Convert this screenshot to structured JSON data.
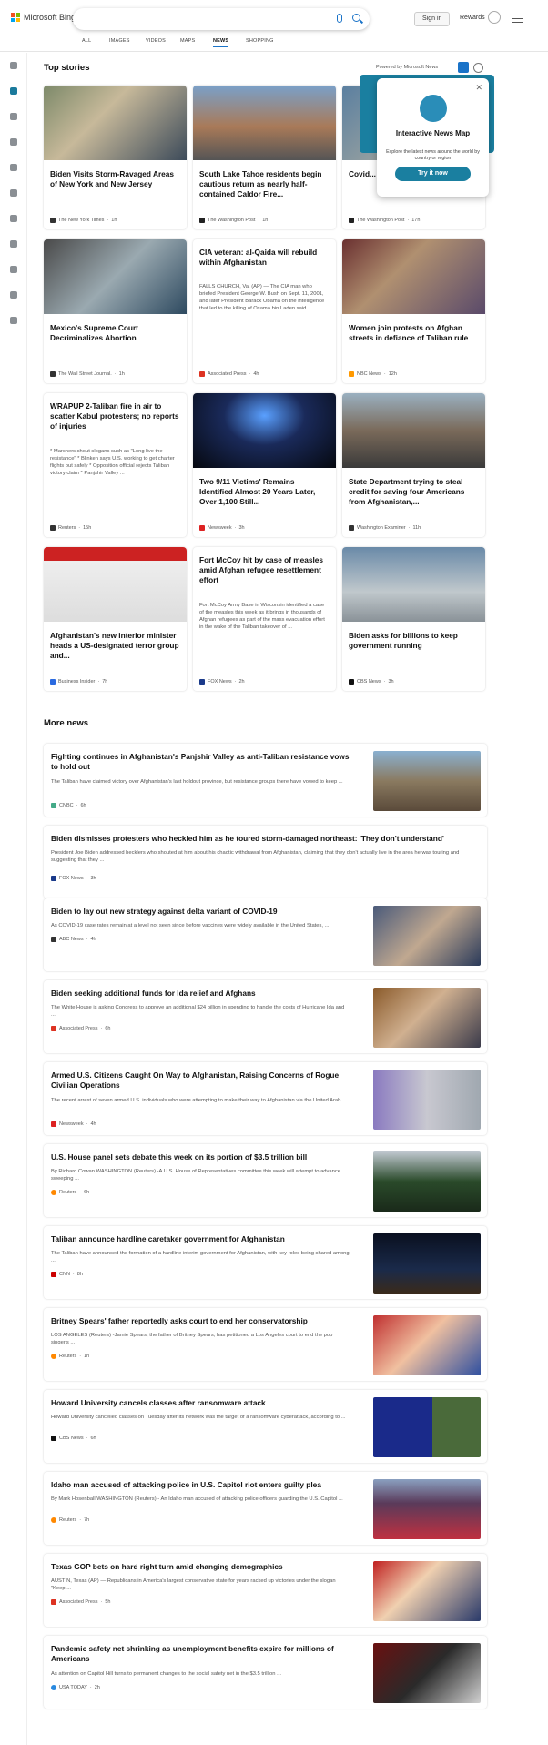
{
  "header": {
    "logo_text": "Microsoft Bing",
    "signin": "Sign in",
    "rewards": "Rewards"
  },
  "tabs": [
    "ALL",
    "IMAGES",
    "VIDEOS",
    "MAPS",
    "NEWS",
    "SHOPPING"
  ],
  "top": {
    "title": "Top stories",
    "powered": "Powered by Microsoft News"
  },
  "popup": {
    "title": "Interactive News Map",
    "desc": "Explore the latest news around the world by country or region",
    "button": "Try it now"
  },
  "cards": [
    {
      "title": "Biden Visits Storm-Ravaged Areas of New York and New Jersey",
      "desc": "",
      "source": "The New York Times",
      "age": "1h"
    },
    {
      "title": "South Lake Tahoe residents begin cautious return as nearly half-contained Caldor Fire...",
      "desc": "",
      "source": "The Washington Post",
      "age": "1h"
    },
    {
      "title": "Covid... move... medi...",
      "desc": "",
      "source": "The Washington Post",
      "age": "17h"
    },
    {
      "title": "Mexico's Supreme Court Decriminalizes Abortion",
      "desc": "",
      "source": "The Wall Street Journal.",
      "age": "1h"
    },
    {
      "title": "CIA veteran: al-Qaida will rebuild within Afghanistan",
      "desc": "FALLS CHURCH, Va. (AP) — The CIA man who briefed President George W. Bush on Sept. 11, 2001, and later President Barack Obama on the intelligence that led to the killing of Osama bin Laden said ...",
      "source": "Associated Press",
      "age": "4h"
    },
    {
      "title": "Women join protests on Afghan streets in defiance of Taliban rule",
      "desc": "",
      "source": "NBC News",
      "age": "12h"
    },
    {
      "title": "WRAPUP 2-Taliban fire in air to scatter Kabul protesters; no reports of injuries",
      "desc": "* Marchers shout slogans such as \"Long live the resistance\" * Blinken says U.S. working to get charter flights out safely * Opposition official rejects Taliban victory claim * Panjshir Valley ...",
      "source": "Reuters",
      "age": "15h"
    },
    {
      "title": "Two 9/11 Victims' Remains Identified Almost 20 Years Later, Over 1,100 Still...",
      "desc": "",
      "source": "Newsweek",
      "age": "3h"
    },
    {
      "title": "State Department trying to steal credit for saving four Americans from Afghanistan,...",
      "desc": "",
      "source": "Washington Examiner",
      "age": "11h"
    },
    {
      "title": "Afghanistan's new interior minister heads a US-designated terror group and...",
      "desc": "",
      "source": "Business Insider",
      "age": "7h"
    },
    {
      "title": "Fort McCoy hit by case of measles amid Afghan refugee resettlement effort",
      "desc": "Fort McCoy Army Base in Wisconsin identified a case of the measles this week as it brings in thousands of Afghan refugees as part of the mass evacuation effort in the wake of the Taliban takeover of ...",
      "source": "FOX News",
      "age": "2h"
    },
    {
      "title": "Biden asks for billions to keep government running",
      "desc": "",
      "source": "CBS News",
      "age": "3h"
    }
  ],
  "more": {
    "title": "More news",
    "items": [
      {
        "title": "Fighting continues in Afghanistan's Panjshir Valley as anti-Taliban resistance vows to hold out",
        "desc": "The Taliban have claimed victory over Afghanistan's last holdout province, but resistance groups there have vowed to keep ...",
        "source": "CNBC",
        "age": "6h"
      },
      {
        "title": "Biden dismisses protesters who heckled him as he toured storm-damaged northeast: 'They don't understand'",
        "desc": "President Joe Biden addressed hecklers who shouted at him about his chaotic withdrawal from Afghanistan, claiming that they don't actually live in the area he was touring and suggesting that they ...",
        "source": "FOX News",
        "age": "3h"
      },
      {
        "title": "Biden to lay out new strategy against delta variant of COVID-19",
        "desc": "As COVID-19 case rates remain at a level not seen since before vaccines were widely available in the United States, ...",
        "source": "ABC News",
        "age": "4h"
      },
      {
        "title": "Biden seeking additional funds for Ida relief and Afghans",
        "desc": "The White House is asking Congress to approve an additional $24 billion in spending to handle the costs of Hurricane Ida and ...",
        "source": "Associated Press",
        "age": "6h"
      },
      {
        "title": "Armed U.S. Citizens Caught On Way to Afghanistan, Raising Concerns of Rogue Civilian Operations",
        "desc": "The recent arrest of seven armed U.S. individuals who were attempting to make their way to Afghanistan via the United Arab ...",
        "source": "Newsweek",
        "age": "4h"
      },
      {
        "title": "U.S. House panel sets debate this week on its portion of $3.5 trillion bill",
        "desc": "By Richard Cowan WASHINGTON (Reuters) -A U.S. House of Representatives committee this week will attempt to advance sweeping ...",
        "source": "Reuters",
        "age": "6h"
      },
      {
        "title": "Taliban announce hardline caretaker government for Afghanistan",
        "desc": "The Taliban have announced the formation of a hardline interim government for Afghanistan, with key roles being shared among ...",
        "source": "CNN",
        "age": "8h"
      },
      {
        "title": "Britney Spears' father reportedly asks court to end her conservatorship",
        "desc": "LOS ANGELES (Reuters) -Jamie Spears, the father of Britney Spears, has petitioned a Los Angeles court to end the pop singer's ...",
        "source": "Reuters",
        "age": "1h"
      },
      {
        "title": "Howard University cancels classes after ransomware attack",
        "desc": "Howard University cancelled classes on Tuesday after its network was the target of a ransomware cyberattack, according to ...",
        "source": "CBS News",
        "age": "6h"
      },
      {
        "title": "Idaho man accused of attacking police in U.S. Capitol riot enters guilty plea",
        "desc": "By Mark Hosenball WASHINGTON (Reuters) - An Idaho man accused of attacking police officers guarding the U.S. Capitol ...",
        "source": "Reuters",
        "age": "7h"
      },
      {
        "title": "Texas GOP bets on hard right turn amid changing demographics",
        "desc": "AUSTIN, Texas (AP) — Republicans in America's largest conservative state for years racked up victories under the slogan \"Keep ...",
        "source": "Associated Press",
        "age": "5h"
      },
      {
        "title": "Pandemic safety net shrinking as unemployment benefits expire for millions of Americans",
        "desc": "As attention on Capitol Hill turns to permanent changes to the social safety net in the $3.5 trillion ...",
        "source": "USA TODAY",
        "age": "2h"
      }
    ]
  }
}
